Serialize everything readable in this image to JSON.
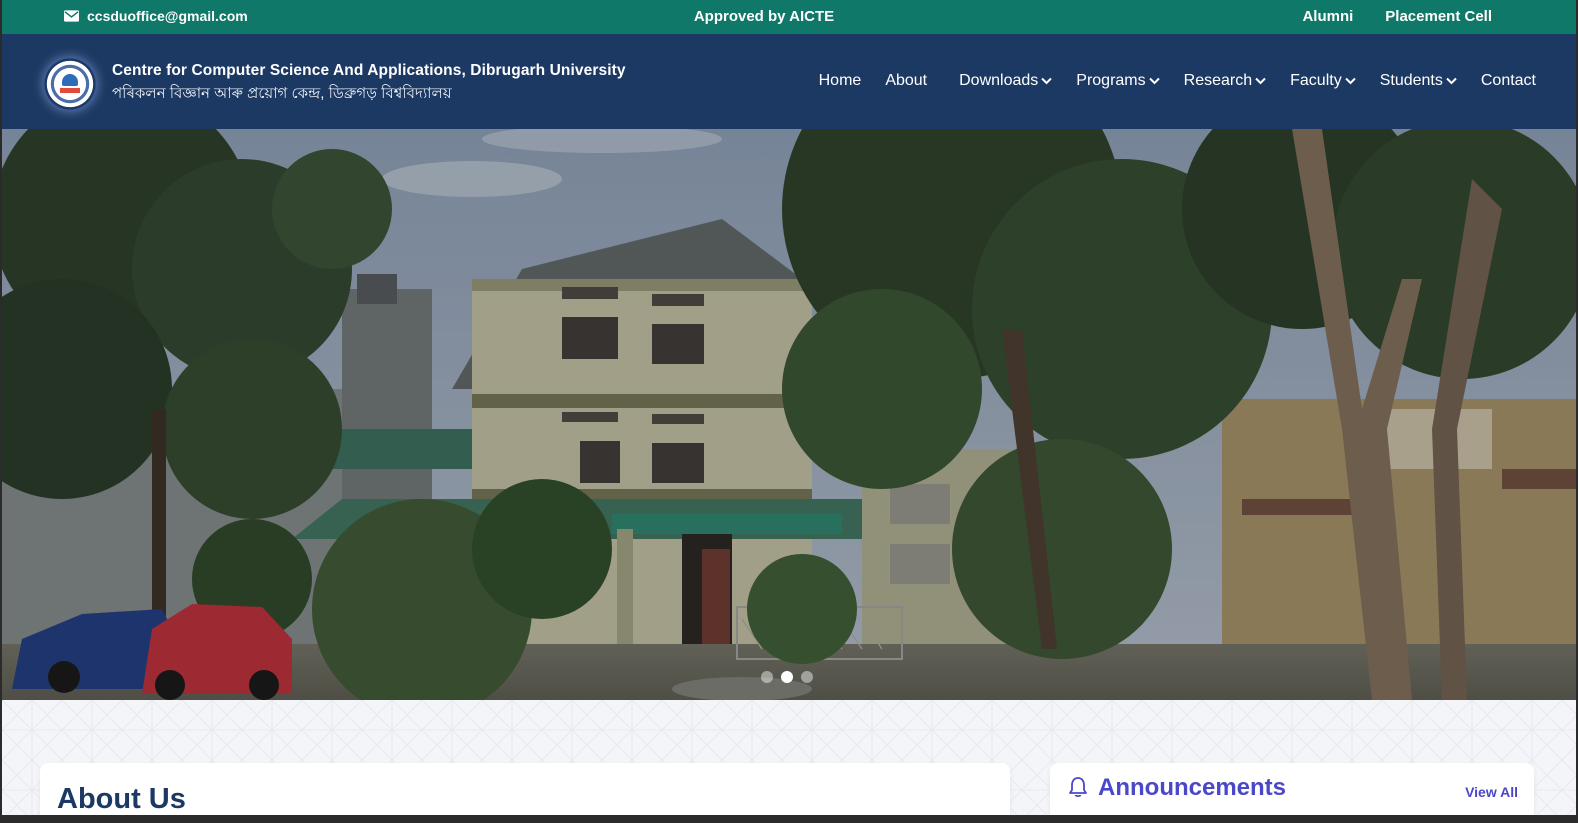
{
  "topbar": {
    "email": "ccsduoffice@gmail.com",
    "approval": "Approved by AICTE",
    "links": [
      "Alumni",
      "Placement Cell"
    ]
  },
  "header": {
    "title_en": "Centre for Computer Science And Applications, Dibrugarh University",
    "title_as": "পৰিকলন বিজ্ঞান আৰু প্ৰয়োগ কেন্দ্ৰ, ডিব্ৰুগড় বিশ্ববিদ্যালয়"
  },
  "nav": {
    "items": [
      {
        "label": "Home",
        "dropdown": false
      },
      {
        "label": "About",
        "dropdown": false
      },
      {
        "label": "Downloads",
        "dropdown": true
      },
      {
        "label": "Programs",
        "dropdown": true
      },
      {
        "label": "Research",
        "dropdown": true
      },
      {
        "label": "Faculty",
        "dropdown": true
      },
      {
        "label": "Students",
        "dropdown": true
      },
      {
        "label": "Contact",
        "dropdown": false
      }
    ]
  },
  "carousel": {
    "slide_count": 3,
    "active_slide": 2
  },
  "about": {
    "heading": "About Us"
  },
  "announcements": {
    "heading": "Announcements",
    "view_all": "View All"
  },
  "colors": {
    "topbar": "#0f7868",
    "navbar": "#1c3963",
    "accent": "#4a47c9"
  },
  "icons": [
    "mail-icon",
    "chevron-down-icon",
    "bell-icon"
  ]
}
